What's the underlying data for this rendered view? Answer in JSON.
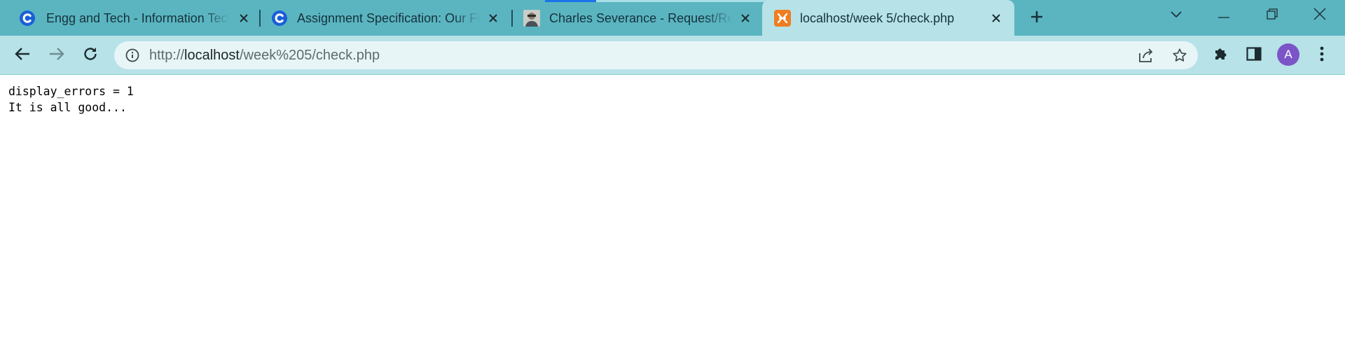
{
  "browser": {
    "tabs": [
      {
        "title": "Engg and Tech - Information Tech",
        "favicon": "c-course-icon",
        "active": false
      },
      {
        "title": "Assignment Specification: Our First",
        "favicon": "c-course-icon",
        "active": false
      },
      {
        "title": "Charles Severance - Request/Response",
        "favicon": "portrait-icon",
        "active": false
      },
      {
        "title": "localhost/week 5/check.php",
        "favicon": "xampp-icon",
        "active": true
      }
    ],
    "new_tab_icon": "plus-icon",
    "window_controls": [
      "tab-search-icon",
      "minimize-icon",
      "restore-icon",
      "close-icon"
    ],
    "address": {
      "scheme": "http://",
      "host": "localhost",
      "path": "/week%205/check.php"
    },
    "toolbar_icons": [
      "back-arrow-icon",
      "forward-arrow-icon",
      "reload-icon",
      "site-info-icon",
      "share-icon",
      "bookmark-star-icon",
      "extensions-puzzle-icon",
      "side-panel-icon",
      "profile-avatar",
      "menu-kebab-icon"
    ],
    "profile_initial": "A",
    "colors": {
      "tabstrip": "#5ab5c1",
      "toolbar": "#b6e2e8",
      "avatar": "#7b55c7",
      "loading": "#1a73e8"
    }
  },
  "page": {
    "lines": [
      "display_errors = 1",
      "It is all good..."
    ]
  }
}
